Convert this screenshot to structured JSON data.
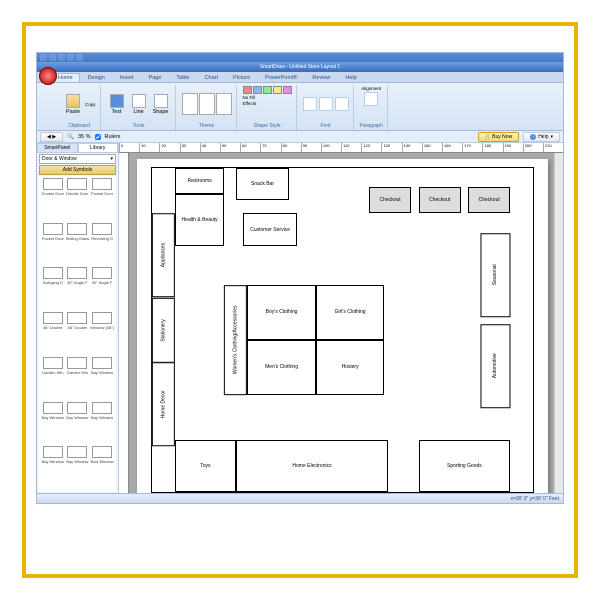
{
  "app": {
    "title": "SmartDraw - Untitled Store Layout 1"
  },
  "ribbon": {
    "tabs": [
      "Home",
      "Design",
      "Insert",
      "Page",
      "Table",
      "Chart",
      "Picture",
      "PowerPoint®",
      "Review",
      "Help"
    ],
    "groups": {
      "clipboard": "Clipboard",
      "tools": "Tools",
      "theme": "Theme",
      "shapestyle": "Shape Style",
      "font": "Font",
      "paragraph": "Paragraph"
    },
    "paste": "Paste",
    "copy": "Copy",
    "text": "Text",
    "line": "Line",
    "shape": "Shape",
    "nofill": "No Fill",
    "effects": "Effects",
    "alignment": "Alignment"
  },
  "toolbar2": {
    "zoom": "35 %",
    "rulers": "Rulers",
    "buynow": "Buy Now",
    "help": "Help"
  },
  "leftpanel": {
    "tabs": [
      "SmartPanel",
      "Library"
    ],
    "category": "Door & Window",
    "add": "Add Symbols",
    "symbols": [
      "Double Door",
      "Double Door",
      "Pocket Door",
      "Pocket Door",
      "Sliding Glass",
      "Revolving D",
      "Swinging D",
      "30° Angle F",
      "30° Angle F",
      "48\" Double",
      "48\" Double",
      "Window (36\")",
      "Garden Win",
      "Garden Win",
      "Bay Window",
      "Bay Window",
      "Bay Window",
      "Bay Window",
      "Bay Window",
      "Bay Window",
      "Bow Window"
    ]
  },
  "ruler": [
    "0",
    "10",
    "20",
    "30",
    "40",
    "50",
    "60",
    "70",
    "80",
    "90",
    "100",
    "110",
    "120",
    "130",
    "140",
    "150",
    "160",
    "170",
    "180",
    "190",
    "200",
    "210"
  ],
  "plan": {
    "rooms": {
      "restrooms": "Restrooms",
      "health": "Health & Beauty",
      "snack": "Snack Bar",
      "customer": "Customer Service",
      "checkout": "Checkout",
      "appliances": "Appliances",
      "stationery": "Stationery",
      "homedecor": "Home Decor",
      "womens": "Women's Clothing/Accessories",
      "boys": "Boy's Clothing",
      "girls": "Girl's Clothing",
      "mens": "Men's Clothing",
      "hosiery": "Hosiery",
      "seasonal": "Seasonal",
      "automotive": "Automotive",
      "toys": "Toys",
      "homeelec": "Home Electronics",
      "sporting": "Sporting Goods"
    }
  },
  "status": {
    "coords": "x=30' 0\"  y=30' 0\" Feet"
  }
}
